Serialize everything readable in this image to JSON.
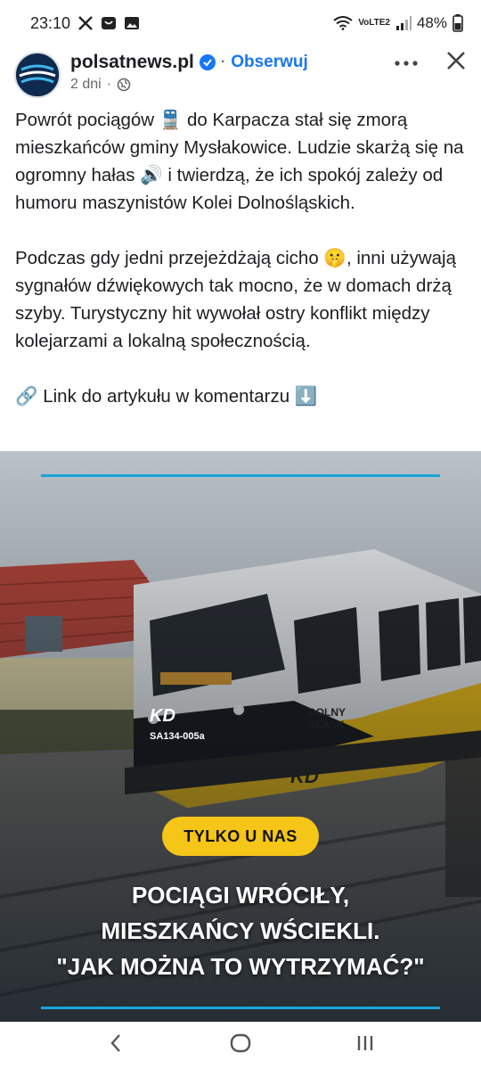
{
  "status_bar": {
    "time": "23:10",
    "network": "VoLTE2",
    "battery": "48%"
  },
  "post": {
    "page_name": "polsatnews.pl",
    "follow_label": "Obserwuj",
    "separator": "·",
    "time_ago": "2 dni",
    "meta_separator": "·",
    "paragraph1": "Powrót pociągów 🚆 do Karpacza stał się zmorą mieszkańców gminy Mysłakowice. Ludzie skarżą się na ogromny hałas 🔊 i twierdzą, że ich spokój zależy od humoru maszynistów Kolei Dolnośląskich.",
    "paragraph2": "Podczas gdy jedni przejeżdżają cicho 🤫, inni używają sygnałów dźwiękowych tak mocno, że w domach drżą szyby. Turystyczny hit wywołał ostry konflikt między kolejarzami a lokalną społecznością.",
    "paragraph3": "🔗 Link do artykułu w komentarzu ⬇️"
  },
  "image": {
    "badge": "TYLKO U NAS",
    "headline_line1": "POCIĄGI WRÓCIŁY,",
    "headline_line2": "MIESZKAŃCY WŚCIEKLI.",
    "headline_line3": "\"JAK MOŻNA TO WYTRZYMAĆ?\"",
    "train_logo": "KD",
    "train_number": "SA134-005a",
    "train_region_line1": "DOLNY",
    "train_region_line2": "ŚLĄSK",
    "accent_color": "#16a6d9",
    "badge_color": "#f5c518"
  },
  "icons": {
    "status": [
      "x-logo-icon",
      "app-notification-icon",
      "gallery-icon",
      "wifi-icon",
      "signal-icon",
      "battery-icon"
    ],
    "header": [
      "verified-badge-icon",
      "globe-icon",
      "more-icon",
      "close-icon"
    ],
    "nav": [
      "back-icon",
      "home-icon",
      "recents-icon"
    ]
  },
  "colors": {
    "brand_blue": "#1877f2",
    "text_primary": "#1c1e21",
    "text_secondary": "#65676b"
  }
}
